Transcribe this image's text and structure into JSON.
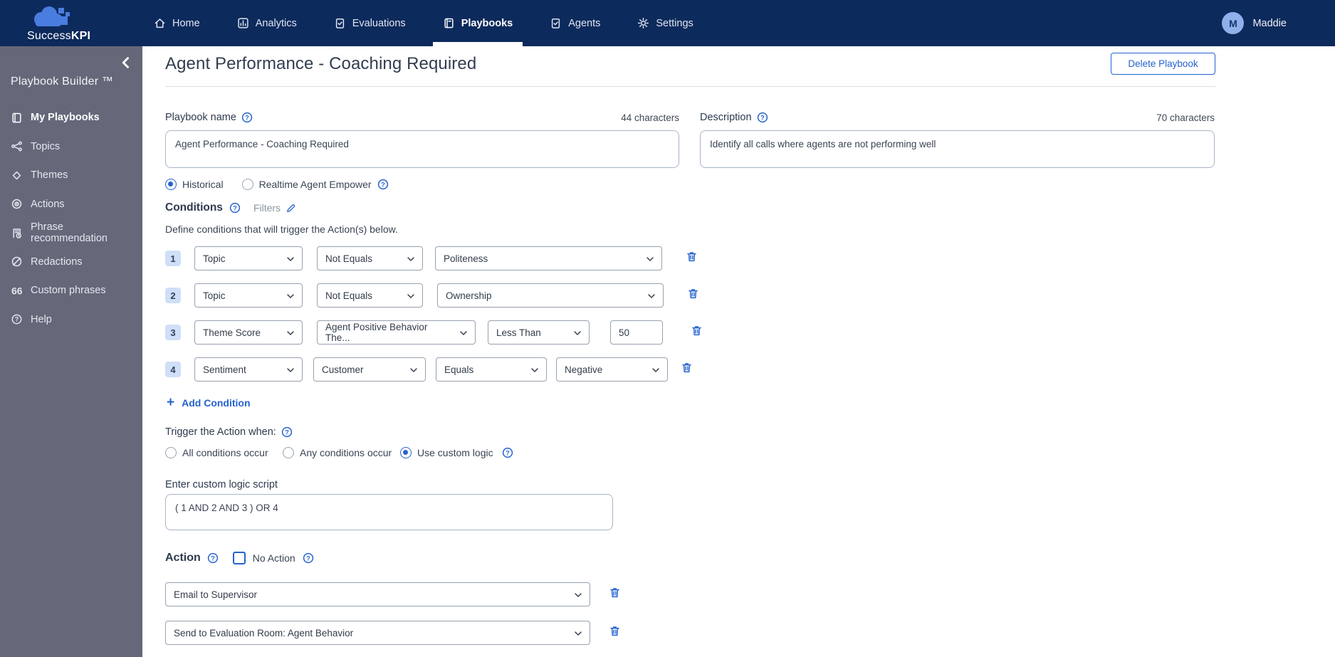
{
  "brand": {
    "name_regular": "Success",
    "name_bold": "KPI",
    "logo_icon": "cloud-blocks-icon"
  },
  "nav": {
    "items": [
      {
        "label": "Home",
        "icon": "home-icon",
        "active": false
      },
      {
        "label": "Analytics",
        "icon": "analytics-icon",
        "active": false
      },
      {
        "label": "Evaluations",
        "icon": "evaluations-icon",
        "active": false
      },
      {
        "label": "Playbooks",
        "icon": "playbooks-icon",
        "active": true
      },
      {
        "label": "Agents",
        "icon": "agents-icon",
        "active": false
      },
      {
        "label": "Settings",
        "icon": "settings-icon",
        "active": false
      }
    ],
    "user": {
      "initial": "M",
      "name": "Maddie"
    }
  },
  "sidebar": {
    "title": "Playbook Builder ™",
    "items": [
      {
        "label": "My Playbooks",
        "icon": "book-icon",
        "active": true
      },
      {
        "label": "Topics",
        "icon": "branch-icon",
        "active": false
      },
      {
        "label": "Themes",
        "icon": "diamond-icon",
        "active": false
      },
      {
        "label": "Actions",
        "icon": "target-icon",
        "active": false
      },
      {
        "label": "Phrase recommendation",
        "icon": "document-clock-icon",
        "active": false
      },
      {
        "label": "Redactions",
        "icon": "slash-circle-icon",
        "active": false
      },
      {
        "label": "Custom phrases",
        "icon": "quotes-icon",
        "active": false
      },
      {
        "label": "Help",
        "icon": "help-circle-icon",
        "active": false
      }
    ]
  },
  "page": {
    "title": "Agent Performance - Coaching Required",
    "delete_button_label": "Delete Playbook"
  },
  "form": {
    "playbook_name": {
      "label": "Playbook name",
      "counter": "44 characters",
      "value": "Agent Performance - Coaching Required"
    },
    "description": {
      "label": "Description",
      "counter": "70 characters",
      "value": "Identify all calls where agents are not performing well"
    },
    "mode_options": [
      {
        "label": "Historical",
        "selected": true,
        "help": false
      },
      {
        "label": "Realtime Agent Empower",
        "selected": false,
        "help": true
      }
    ],
    "conditions": {
      "title": "Conditions",
      "filters_label": "Filters",
      "subtitle": "Define conditions that will trigger the Action(s) below.",
      "rows": [
        {
          "num": "1",
          "fields": [
            {
              "kind": "select",
              "value": "Topic"
            },
            {
              "kind": "select",
              "value": "Not Equals"
            },
            {
              "kind": "select",
              "value": "Politeness"
            }
          ]
        },
        {
          "num": "2",
          "fields": [
            {
              "kind": "select",
              "value": "Topic"
            },
            {
              "kind": "select",
              "value": "Not Equals"
            },
            {
              "kind": "select",
              "value": "Ownership"
            }
          ]
        },
        {
          "num": "3",
          "fields": [
            {
              "kind": "select",
              "value": "Theme Score"
            },
            {
              "kind": "select",
              "value": "Agent Positive Behavior The..."
            },
            {
              "kind": "select",
              "value": "Less Than"
            },
            {
              "kind": "input",
              "value": "50"
            }
          ]
        },
        {
          "num": "4",
          "fields": [
            {
              "kind": "select",
              "value": "Sentiment"
            },
            {
              "kind": "select",
              "value": "Customer"
            },
            {
              "kind": "select",
              "value": "Equals"
            },
            {
              "kind": "select",
              "value": "Negative"
            }
          ]
        }
      ],
      "add_label": "Add Condition"
    },
    "trigger": {
      "label": "Trigger the Action when:",
      "options": [
        {
          "label": "All conditions occur",
          "selected": false,
          "help": false
        },
        {
          "label": "Any conditions occur",
          "selected": false,
          "help": false
        },
        {
          "label": "Use custom logic",
          "selected": true,
          "help": true
        }
      ]
    },
    "custom_logic": {
      "label": "Enter custom logic script",
      "value": "( 1 AND 2 AND 3 ) OR 4"
    },
    "action": {
      "title": "Action",
      "no_action_label": "No Action",
      "no_action_checked": false,
      "rows": [
        {
          "value": "Email to Supervisor"
        },
        {
          "value": "Send to Evaluation Room: Agent Behavior"
        }
      ]
    }
  },
  "colors": {
    "navbar": "#0d2a5c",
    "sidebar": "#646879",
    "accent": "#2563cf",
    "badge_bg": "#cfdff7"
  }
}
